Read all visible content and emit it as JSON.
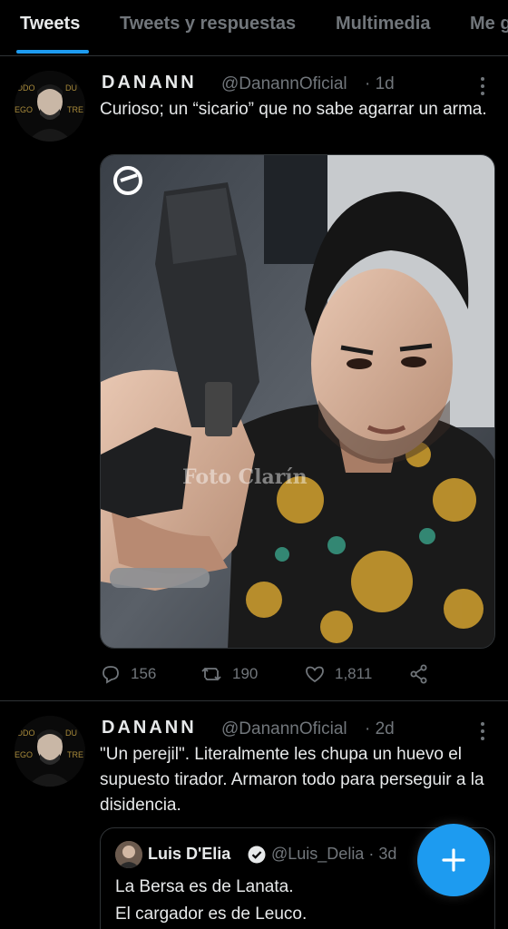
{
  "tabs": [
    {
      "label": "Tweets",
      "active": true
    },
    {
      "label": "Tweets y respuestas",
      "active": false
    },
    {
      "label": "Multimedia",
      "active": false
    },
    {
      "label": "Me g",
      "active": false
    }
  ],
  "tweets": [
    {
      "name": "DANANN",
      "handle": "@DanannOficial",
      "time": "· 1d",
      "text": "Curioso; un “sicario” que no sabe agarrar un arma.",
      "media_watermark": "Foto Clarín",
      "stats": {
        "replies": "156",
        "retweets": "190",
        "likes": "1,811"
      }
    },
    {
      "name": "DANANN",
      "handle": "@DanannOficial",
      "time": "· 2d",
      "text": "\"Un perejil\". Literalmente les chupa un huevo el supuesto tirador. Armaron todo para perseguir a la disidencia.",
      "quote": {
        "name": "Luis D'Elia",
        "handle": "@Luis_Delia",
        "time": "· 3d",
        "line1": "La Bersa es de Lanata.",
        "line2": "El cargador es de Leuco."
      }
    }
  ],
  "icons": {
    "reply": "reply-icon",
    "retweet": "retweet-icon",
    "like": "heart-icon",
    "share": "share-icon",
    "compose": "plus-icon",
    "verified": "verified-badge-icon"
  },
  "colors": {
    "accent": "#1d9bf0",
    "muted": "#71767b",
    "text": "#e7e9ea",
    "background": "#000000"
  }
}
